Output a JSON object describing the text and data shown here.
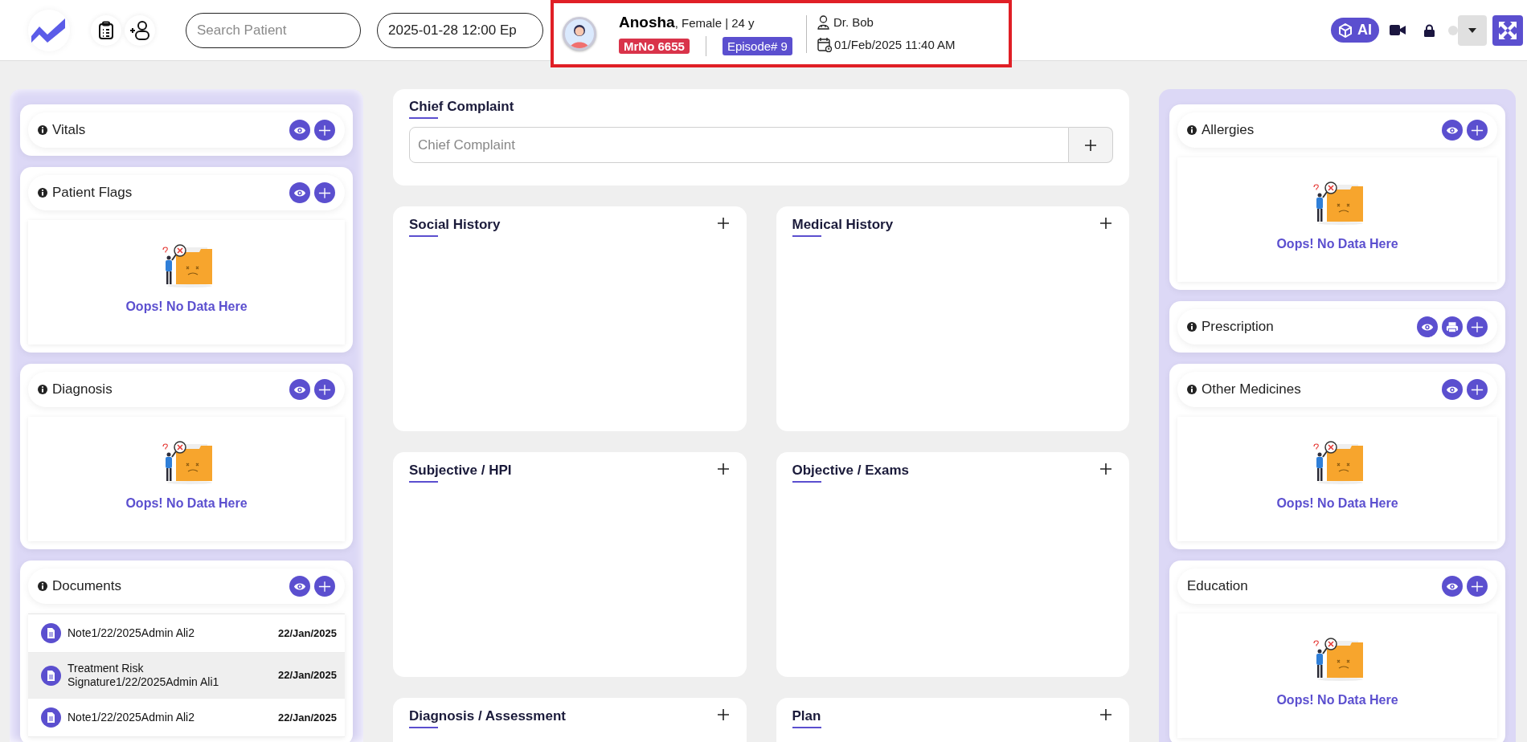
{
  "header": {
    "search": {
      "placeholder": "Search Patient"
    },
    "episode_field": {
      "value": "2025-01-28 12:00 Ep"
    },
    "patient": {
      "name": "Anosha",
      "details": ", Female | 24 y",
      "mrno": "MrNo 6655",
      "episode": "Episode# 9",
      "doctor": "Dr. Bob",
      "datetime": "01/Feb/2025 11:40 AM"
    },
    "ai_button": {
      "label": "AI"
    }
  },
  "left_panel": [
    {
      "title": "Vitals",
      "info": true,
      "kind": "header",
      "actions": [
        {
          "kind": "view"
        },
        {
          "kind": "add"
        }
      ]
    },
    {
      "title": "Patient Flags",
      "info": true,
      "kind": "empty",
      "actions": [
        {
          "kind": "view"
        },
        {
          "kind": "add"
        }
      ],
      "empty_text": "Oops! No Data Here"
    },
    {
      "title": "Diagnosis",
      "info": true,
      "kind": "empty",
      "actions": [
        {
          "kind": "view"
        },
        {
          "kind": "add"
        }
      ],
      "empty_text": "Oops! No Data Here"
    },
    {
      "title": "Documents",
      "info": true,
      "kind": "documents",
      "actions": [
        {
          "kind": "view"
        },
        {
          "kind": "add"
        }
      ],
      "documents": [
        {
          "name": "Note1/22/2025Admin Ali2",
          "date": "22/Jan/2025",
          "selected": false
        },
        {
          "name": "Treatment Risk Signature1/22/2025Admin Ali1",
          "date": "22/Jan/2025",
          "selected": true
        },
        {
          "name": "Note1/22/2025Admin Ali2",
          "date": "22/Jan/2025",
          "selected": false
        }
      ]
    }
  ],
  "chief_complaint": {
    "title": "Chief Complaint",
    "placeholder": "Chief Complaint"
  },
  "sections": [
    {
      "title": "Social History"
    },
    {
      "title": "Medical History"
    },
    {
      "title": "Subjective / HPI"
    },
    {
      "title": "Objective / Exams"
    },
    {
      "title": "Diagnosis / Assessment"
    },
    {
      "title": "Plan"
    }
  ],
  "right_panel": [
    {
      "title": "Allergies",
      "info": true,
      "kind": "empty",
      "actions": [
        {
          "kind": "view"
        },
        {
          "kind": "add"
        }
      ],
      "empty_text": "Oops! No Data Here"
    },
    {
      "title": "Prescription",
      "info": true,
      "kind": "header",
      "actions": [
        {
          "kind": "view"
        },
        {
          "kind": "print"
        },
        {
          "kind": "add"
        }
      ]
    },
    {
      "title": "Other Medicines",
      "info": true,
      "kind": "empty",
      "actions": [
        {
          "kind": "view"
        },
        {
          "kind": "add"
        }
      ],
      "empty_text": "Oops! No Data Here"
    },
    {
      "title": "Education",
      "info": false,
      "kind": "empty",
      "actions": [
        {
          "kind": "view"
        },
        {
          "kind": "add"
        }
      ],
      "empty_text": "Oops! No Data Here"
    }
  ]
}
